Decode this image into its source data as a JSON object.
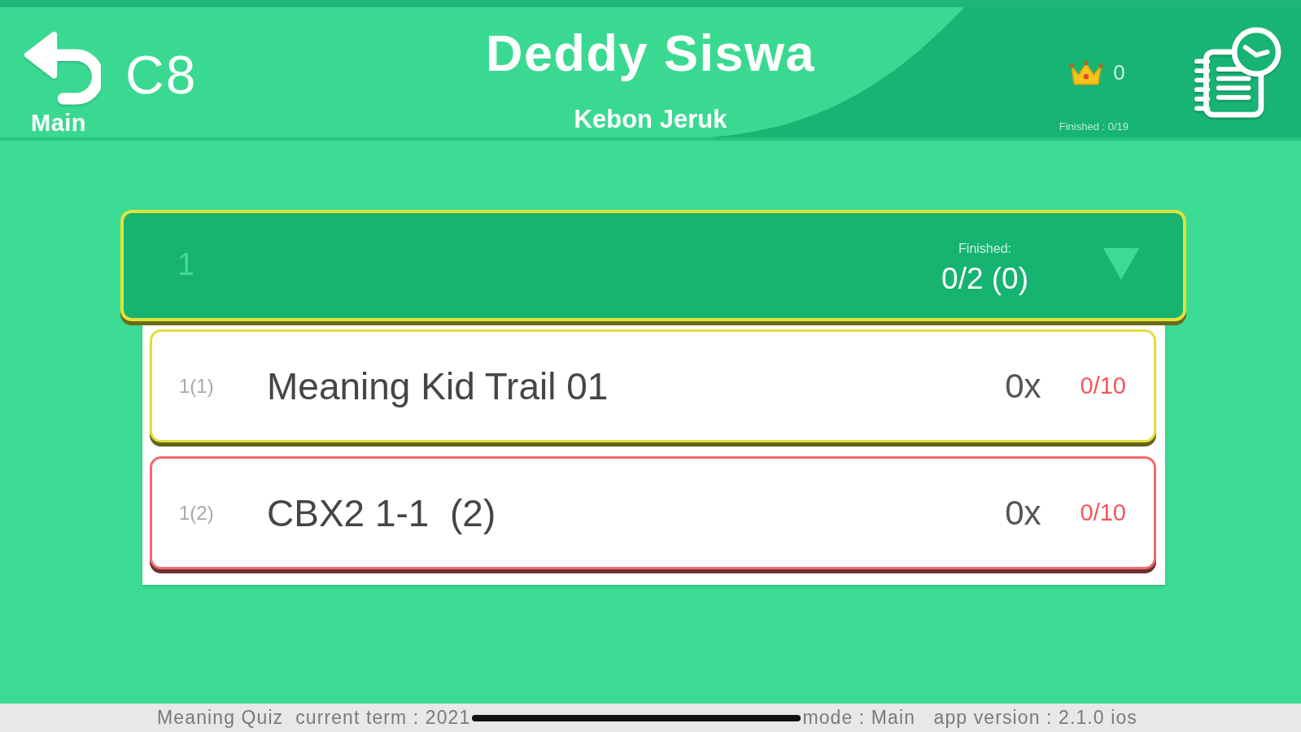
{
  "header": {
    "back_button": {
      "label": "Main"
    },
    "level": "C8",
    "title": "Deddy Siswa",
    "subtitle": "Kebon Jeruk",
    "crowns": "0",
    "finished": "Finished : 0/19"
  },
  "groups": [
    {
      "label": "1",
      "finished_label": "Finished:",
      "finished_value": "0/2 (0)",
      "expanded": true,
      "items": [
        {
          "index": "1(1)",
          "title": "Meaning Kid Trail 01",
          "count": "0x",
          "score": "0/10",
          "color": "#e2dc3c"
        },
        {
          "index": "1(2)",
          "title": "CBX2 1-1  (2)",
          "count": "0x",
          "score": "0/10",
          "color": "#f26b6b"
        }
      ]
    }
  ],
  "footer": {
    "texts": [
      "Meaning Quiz  current term : 2021",
      "mode : Main   app version : 2.1.0 ios"
    ]
  }
}
